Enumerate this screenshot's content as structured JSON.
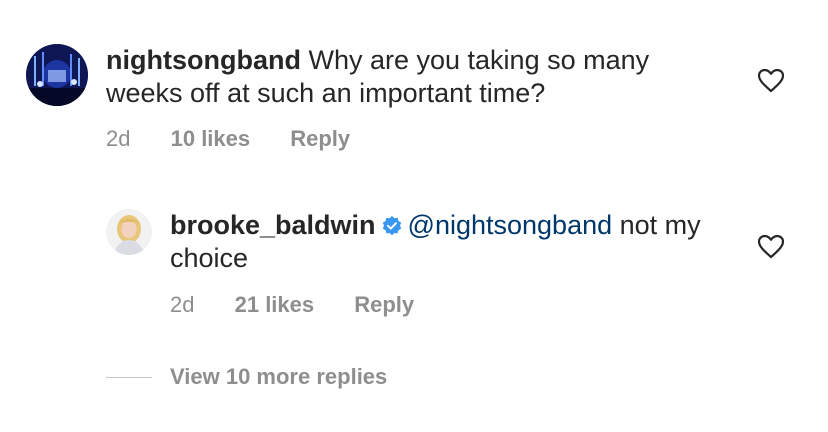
{
  "comments": [
    {
      "username": "nightsongband",
      "text": "Why are you taking so many weeks off at such an important time?",
      "time": "2d",
      "likes": "10 likes",
      "reply_label": "Reply",
      "avatar": "concert-stage-avatar"
    }
  ],
  "replies": [
    {
      "username": "brooke_baldwin",
      "verified": true,
      "mention": "@nightsongband",
      "text": "not my choice",
      "time": "2d",
      "likes": "21 likes",
      "reply_label": "Reply",
      "avatar": "person-avatar"
    }
  ],
  "view_more": "View 10 more replies",
  "colors": {
    "text": "#262626",
    "muted": "#8e8e8e",
    "mention": "#00376b",
    "verified": "#3897f0"
  },
  "icons": [
    "heart-icon",
    "verified-badge-icon"
  ]
}
